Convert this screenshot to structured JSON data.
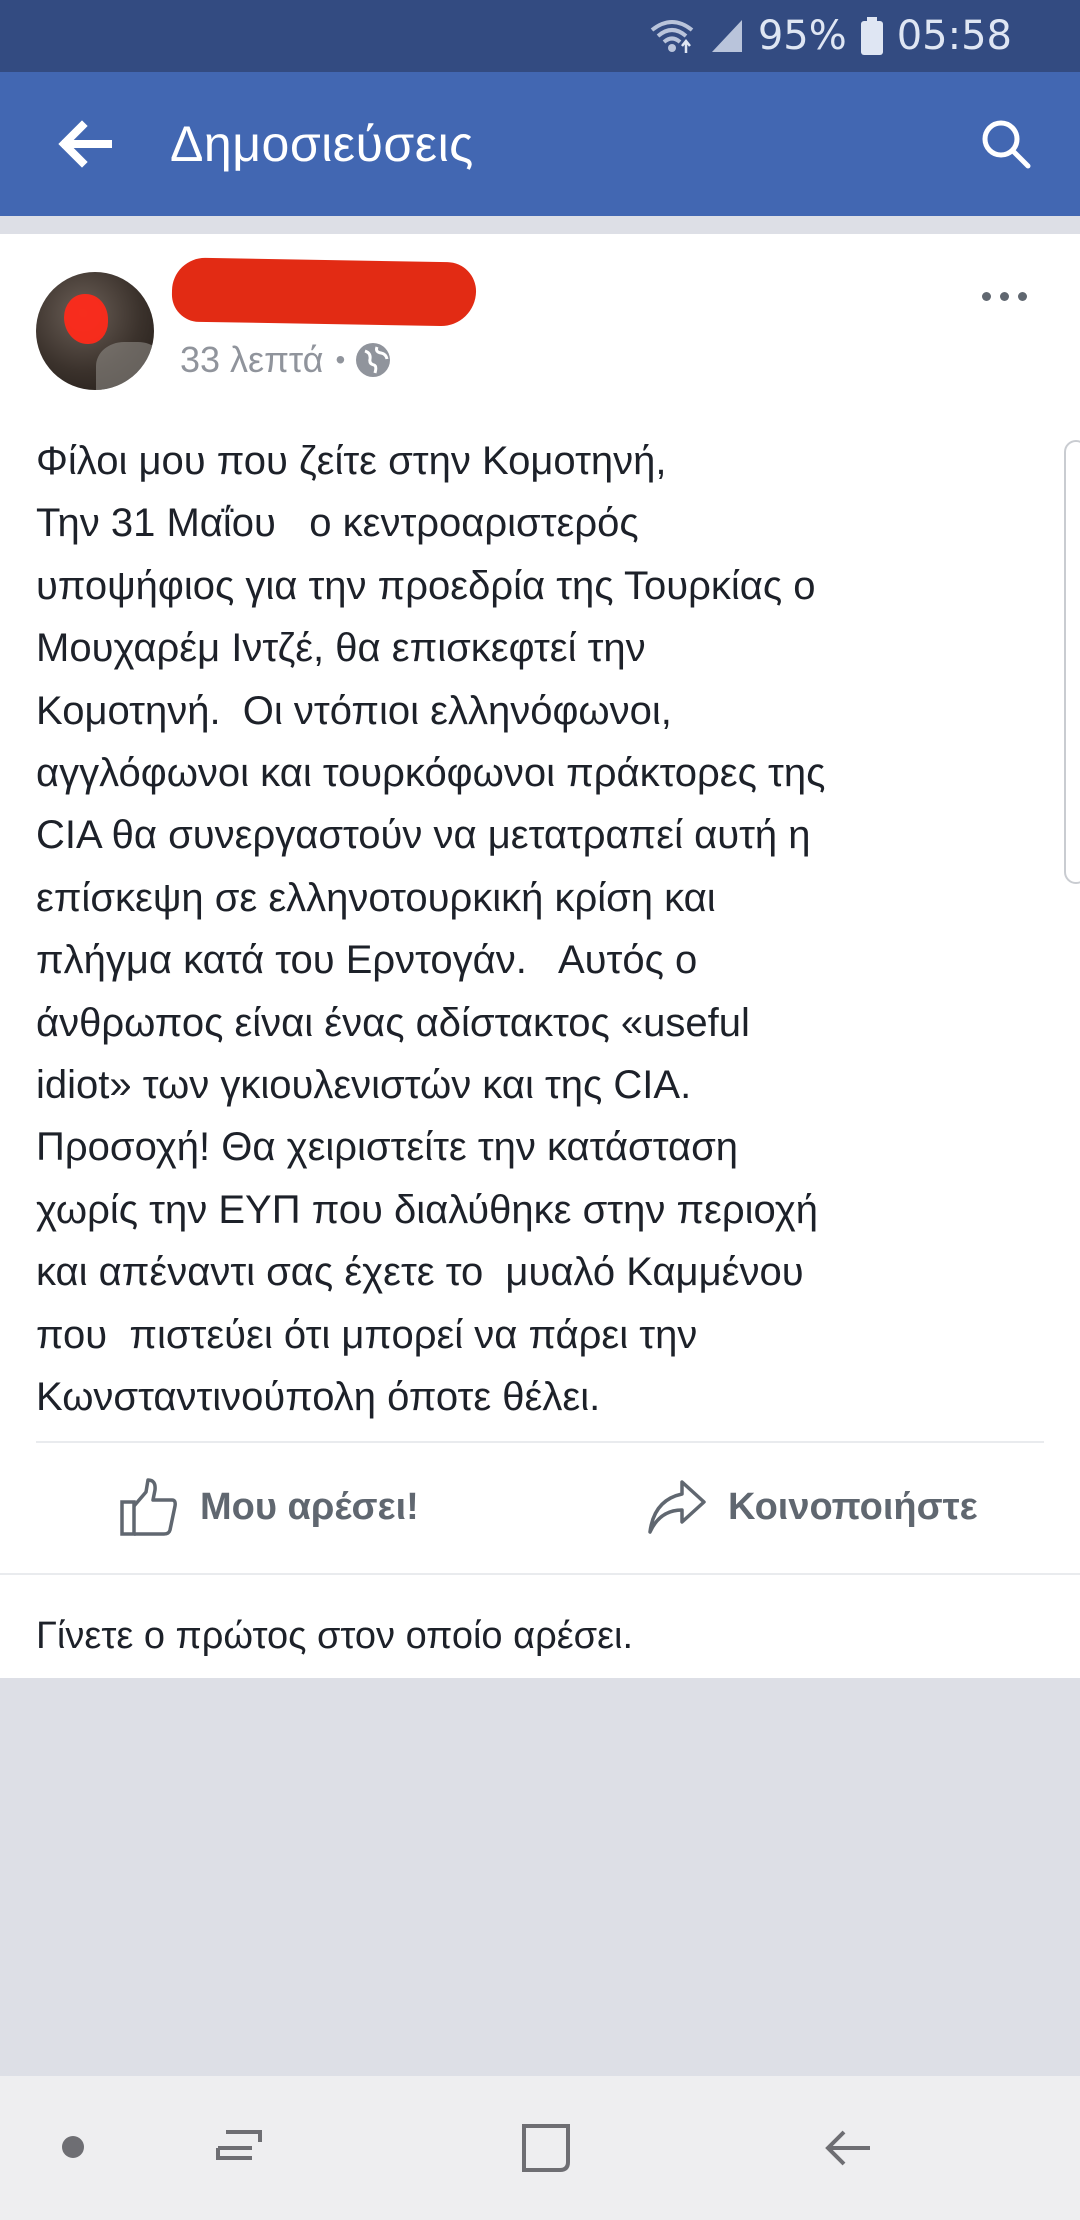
{
  "status_bar": {
    "battery": "95%",
    "time": "05:58",
    "icons": [
      "wifi-icon",
      "signal-icon",
      "battery-icon"
    ]
  },
  "app_bar": {
    "title": "Δημοσιεύσεις",
    "back_icon": "back-arrow-icon",
    "search_icon": "search-icon"
  },
  "post": {
    "time": "33 λεπτά",
    "privacy_icon": "globe-icon",
    "body": "Φίλοι μου που ζείτε στην Κομοτηνή,\nΤην 31 Μαΐου   ο κεντροαριστερός\nυποψήφιος για την προεδρία της Τουρκίας ο\nΜουχαρέμ Ιντζέ, θα επισκεφτεί την\nΚομοτηνή.  Οι ντόπιοι ελληνόφωνοι,\nαγγλόφωνοι και τουρκόφωνοι πράκτορες της\nCIA θα συνεργαστούν να μετατραπεί αυτή η\nεπίσκεψη σε ελληνοτουρκική κρίση και\nπλήγμα κατά του Ερντογάν.   Αυτός ο\nάνθρωπος είναι ένας αδίστακτος «useful\nidiot» των γκιουλενιστών και της CIA.\nΠροσοχή! Θα χειριστείτε την κατάσταση\nχωρίς την ΕΥΠ που διαλύθηκε στην περιοχή\nκαι απέναντι σας έχετε το  μυαλό Καμμένου\nπου  πιστεύει ότι μπορεί να πάρει την\nΚωνσταντινούπολη όποτε θέλει.",
    "like_label": "Μου αρέσει!",
    "share_label": "Κοινοποιήστε",
    "likes_note": "Γίνετε ο πρώτος στον οποίο αρέσει."
  },
  "nav_bar": {
    "icons": [
      "assistant-dot-icon",
      "recents-icon",
      "home-icon",
      "back-icon"
    ]
  },
  "colors": {
    "status_bar": "#334b81",
    "app_bar": "#4267b2",
    "background": "#dddfe6",
    "redaction": "#e22b14",
    "text": "#1d2129",
    "muted": "#90949c"
  }
}
